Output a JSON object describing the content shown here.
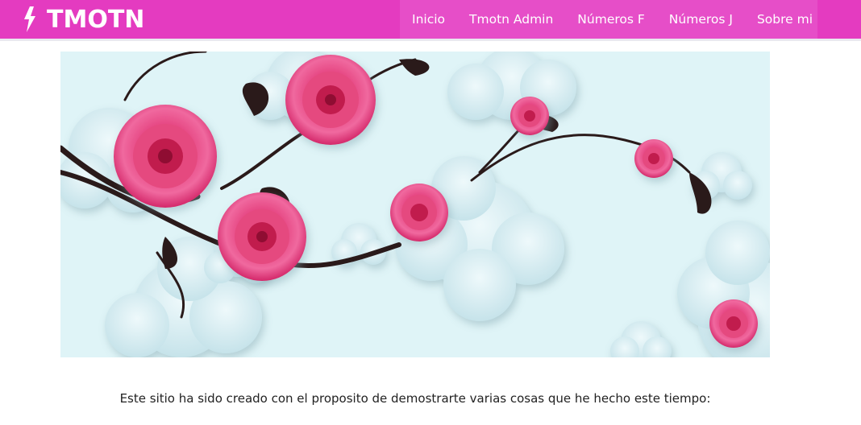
{
  "header": {
    "brand_text": "TMOTN",
    "brand_icon": "lightning-bolt-icon",
    "brand_color": "#e43bc0"
  },
  "nav": {
    "items": [
      {
        "label": "Inicio"
      },
      {
        "label": "Tmotn Admin"
      },
      {
        "label": "Números F"
      },
      {
        "label": "Números J"
      },
      {
        "label": "Sobre mi"
      }
    ]
  },
  "hero": {
    "image": "pink-roses-on-light-blue-paper-clouds-illustration"
  },
  "content": {
    "intro": "Este sitio ha sido creado con el proposito de demostrarte varias cosas que he hecho este tiempo:"
  }
}
